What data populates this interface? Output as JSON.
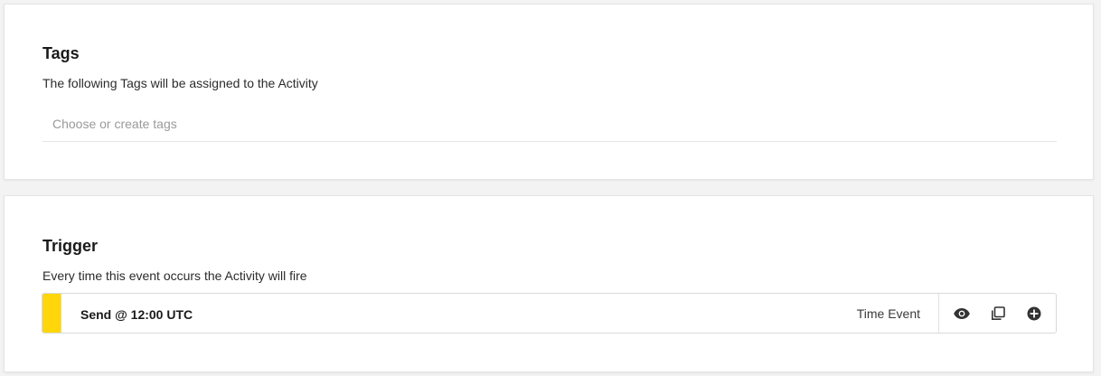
{
  "tags_section": {
    "title": "Tags",
    "description": "The following Tags will be assigned to the Activity",
    "input": {
      "value": "",
      "placeholder": "Choose or create tags"
    }
  },
  "trigger_section": {
    "title": "Trigger",
    "description": "Every time this event occurs the Activity will fire",
    "trigger": {
      "name": "Send @ 12:00 UTC",
      "type": "Time Event",
      "accent_color": "#ffd60a",
      "actions": [
        {
          "icon": "eye-icon"
        },
        {
          "icon": "copy-icon"
        },
        {
          "icon": "plus-circle-icon"
        }
      ]
    }
  }
}
